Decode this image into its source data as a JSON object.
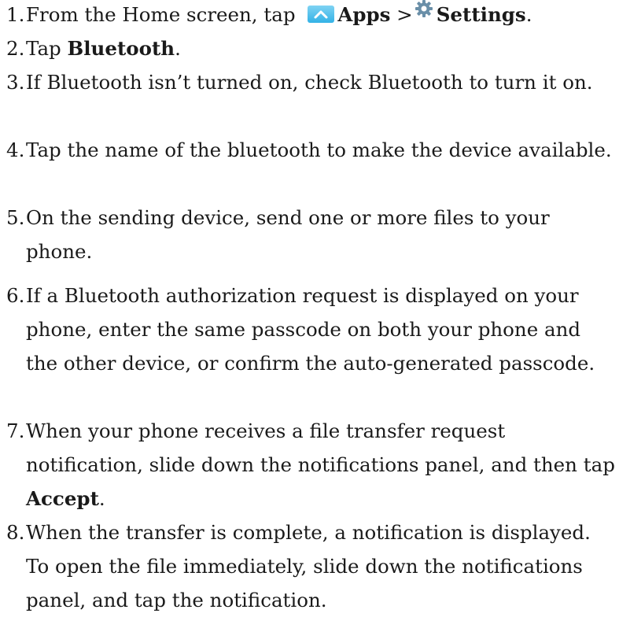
{
  "steps": [
    {
      "num": "1.",
      "pre": "From the Home screen, tap ",
      "apps_label": "Apps",
      "separator": " >",
      "settings_label": "Settings",
      "post": "."
    },
    {
      "num": "2.",
      "pre": "Tap ",
      "bold": "Bluetooth",
      "post": "."
    },
    {
      "num": "3.",
      "text": "If Bluetooth isn’t turned on, check Bluetooth to turn it on."
    },
    {
      "num": "4.",
      "text": "Tap the name of the bluetooth to make the device available."
    },
    {
      "num": "5.",
      "text": "On the sending device, send one or more files to your phone."
    },
    {
      "num": "6.",
      "text": "If a Bluetooth authorization request is displayed on your phone, enter the same passcode on both your phone and the other device, or confirm the auto-generated passcode."
    },
    {
      "num": "7.",
      "pre": "When your phone receives a file transfer request notification, slide down the notifications panel, and then tap ",
      "bold": "Accept",
      "post": "."
    },
    {
      "num": "8.",
      "text": "When the transfer is complete, a notification is displayed. To open the file immediately, slide down the notifications panel, and tap the notification."
    }
  ],
  "icons": {
    "apps": "apps-icon",
    "settings": "gear-icon",
    "apps_color": "#33b2e6",
    "settings_color": "#6a8fa8"
  }
}
